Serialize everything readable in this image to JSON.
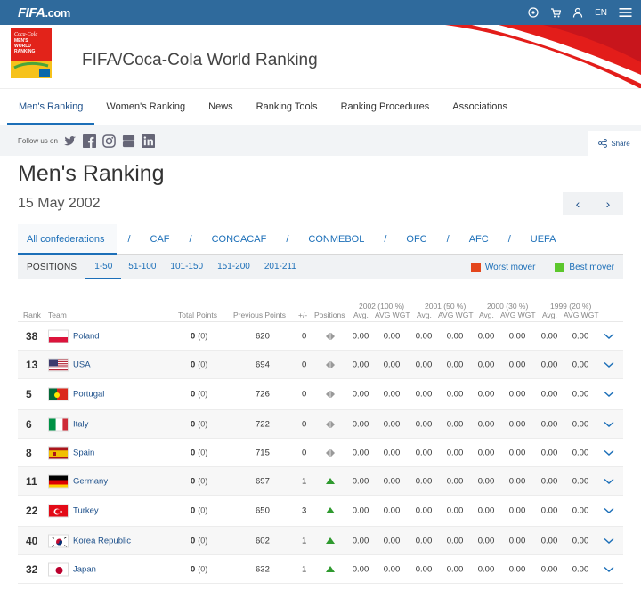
{
  "topbar": {
    "logo": "FIFA",
    "logo_suffix": ".com",
    "lang": "EN"
  },
  "hero": {
    "title": "FIFA/Coca-Cola World Ranking",
    "badge_text": [
      "Coca-Cola",
      "MEN'S",
      "WORLD",
      "RANKING"
    ]
  },
  "nav": [
    "Men's Ranking",
    "Women's Ranking",
    "News",
    "Ranking Tools",
    "Ranking Procedures",
    "Associations"
  ],
  "follow": {
    "label": "Follow us on",
    "share": "Share"
  },
  "page": {
    "title": "Men's Ranking",
    "date": "15 May 2002",
    "prev": "‹",
    "next": "›"
  },
  "confederations": [
    "All confederations",
    "CAF",
    "CONCACAF",
    "CONMEBOL",
    "OFC",
    "AFC",
    "UEFA"
  ],
  "positions": {
    "label": "POSITIONS",
    "tabs": [
      "1-50",
      "51-100",
      "101-150",
      "151-200",
      "201-211"
    ],
    "worst": "Worst mover",
    "best": "Best mover",
    "worst_color": "#e4461c",
    "best_color": "#5cc72c"
  },
  "years": [
    "2002 (100 %)",
    "2001 (50 %)",
    "2000 (30 %)",
    "1999 (20 %)"
  ],
  "headers": {
    "rank": "Rank",
    "team": "Team",
    "total": "Total Points",
    "previous": "Previous Points",
    "pm": "+/-",
    "positions": "Positions",
    "avg": "Avg.",
    "avg_wgt": "AVG WGT"
  },
  "rows": [
    {
      "rank": "38",
      "country": "Poland",
      "flag": "poland",
      "pts": "0",
      "pts_sub": "(0)",
      "prev": "620",
      "pm": "0",
      "move": "same",
      "vals": [
        "0.00",
        "0.00",
        "0.00",
        "0.00",
        "0.00",
        "0.00",
        "0.00",
        "0.00"
      ]
    },
    {
      "rank": "13",
      "country": "USA",
      "flag": "usa",
      "pts": "0",
      "pts_sub": "(0)",
      "prev": "694",
      "pm": "0",
      "move": "same",
      "vals": [
        "0.00",
        "0.00",
        "0.00",
        "0.00",
        "0.00",
        "0.00",
        "0.00",
        "0.00"
      ]
    },
    {
      "rank": "5",
      "country": "Portugal",
      "flag": "portugal",
      "pts": "0",
      "pts_sub": "(0)",
      "prev": "726",
      "pm": "0",
      "move": "same",
      "vals": [
        "0.00",
        "0.00",
        "0.00",
        "0.00",
        "0.00",
        "0.00",
        "0.00",
        "0.00"
      ]
    },
    {
      "rank": "6",
      "country": "Italy",
      "flag": "italy",
      "pts": "0",
      "pts_sub": "(0)",
      "prev": "722",
      "pm": "0",
      "move": "same",
      "vals": [
        "0.00",
        "0.00",
        "0.00",
        "0.00",
        "0.00",
        "0.00",
        "0.00",
        "0.00"
      ]
    },
    {
      "rank": "8",
      "country": "Spain",
      "flag": "spain",
      "pts": "0",
      "pts_sub": "(0)",
      "prev": "715",
      "pm": "0",
      "move": "same",
      "vals": [
        "0.00",
        "0.00",
        "0.00",
        "0.00",
        "0.00",
        "0.00",
        "0.00",
        "0.00"
      ]
    },
    {
      "rank": "11",
      "country": "Germany",
      "flag": "germany",
      "pts": "0",
      "pts_sub": "(0)",
      "prev": "697",
      "pm": "1",
      "move": "up",
      "vals": [
        "0.00",
        "0.00",
        "0.00",
        "0.00",
        "0.00",
        "0.00",
        "0.00",
        "0.00"
      ]
    },
    {
      "rank": "22",
      "country": "Turkey",
      "flag": "turkey",
      "pts": "0",
      "pts_sub": "(0)",
      "prev": "650",
      "pm": "3",
      "move": "up",
      "vals": [
        "0.00",
        "0.00",
        "0.00",
        "0.00",
        "0.00",
        "0.00",
        "0.00",
        "0.00"
      ]
    },
    {
      "rank": "40",
      "country": "Korea Republic",
      "flag": "korea",
      "pts": "0",
      "pts_sub": "(0)",
      "prev": "602",
      "pm": "1",
      "move": "up",
      "vals": [
        "0.00",
        "0.00",
        "0.00",
        "0.00",
        "0.00",
        "0.00",
        "0.00",
        "0.00"
      ]
    },
    {
      "rank": "32",
      "country": "Japan",
      "flag": "japan",
      "pts": "0",
      "pts_sub": "(0)",
      "prev": "632",
      "pm": "1",
      "move": "up",
      "vals": [
        "0.00",
        "0.00",
        "0.00",
        "0.00",
        "0.00",
        "0.00",
        "0.00",
        "0.00"
      ]
    }
  ]
}
